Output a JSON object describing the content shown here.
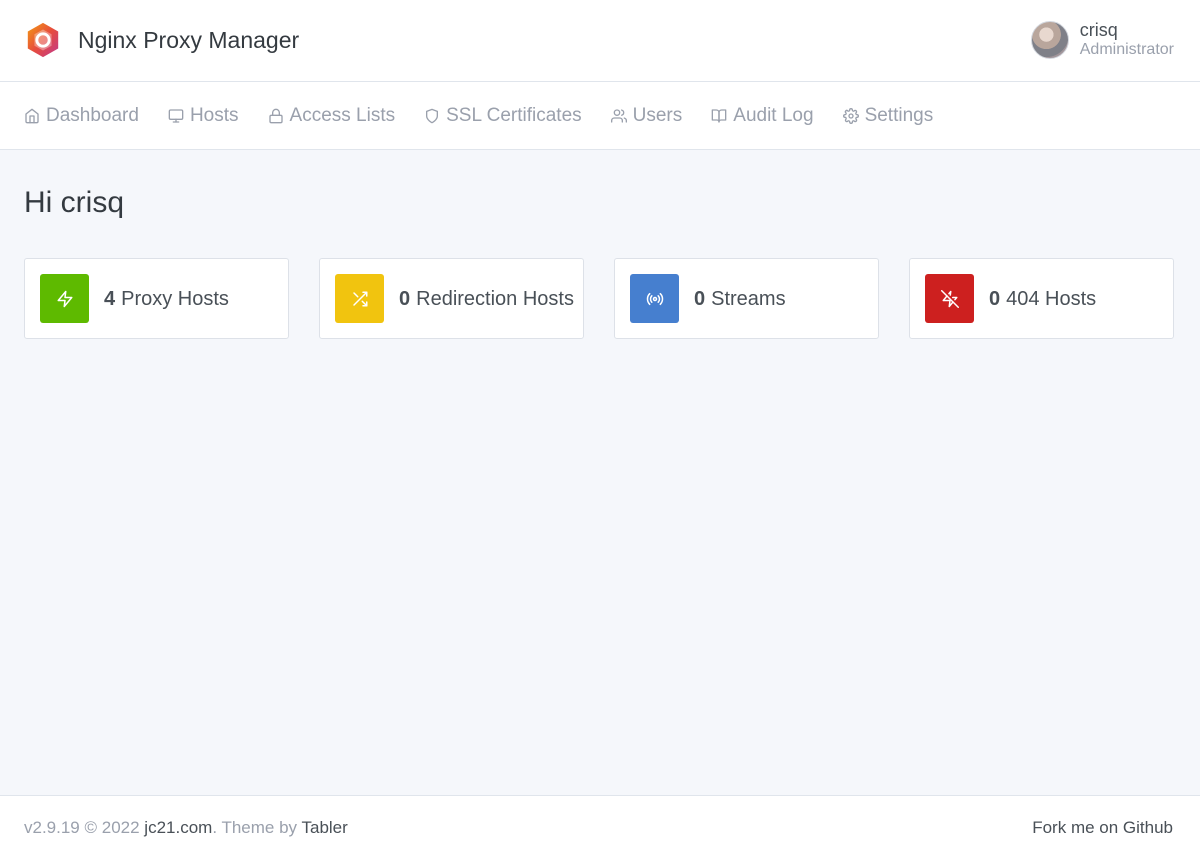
{
  "header": {
    "title": "Nginx Proxy Manager",
    "logo_icon": "nginx-proxy-manager-logo",
    "user": {
      "name": "crisq",
      "role": "Administrator",
      "avatar_icon": "user-avatar"
    }
  },
  "nav": {
    "items": [
      {
        "label": "Dashboard",
        "icon": "home-icon"
      },
      {
        "label": "Hosts",
        "icon": "monitor-icon"
      },
      {
        "label": "Access Lists",
        "icon": "lock-icon"
      },
      {
        "label": "SSL Certificates",
        "icon": "shield-icon"
      },
      {
        "label": "Users",
        "icon": "users-icon"
      },
      {
        "label": "Audit Log",
        "icon": "book-open-icon"
      },
      {
        "label": "Settings",
        "icon": "gear-icon"
      }
    ]
  },
  "main": {
    "greeting": "Hi crisq",
    "cards": [
      {
        "count": "4",
        "label": "Proxy Hosts",
        "icon": "zap-icon",
        "color": "#5eba00"
      },
      {
        "count": "0",
        "label": "Redirection Hosts",
        "icon": "shuffle-icon",
        "color": "#f1c40f"
      },
      {
        "count": "0",
        "label": "Streams",
        "icon": "radio-icon",
        "color": "#467fcf"
      },
      {
        "count": "0",
        "label": "404 Hosts",
        "icon": "zap-off-icon",
        "color": "#cd201f"
      }
    ]
  },
  "footer": {
    "version": "v2.9.19 © 2022",
    "company_link": "jc21.com",
    "theme_text": ". Theme by",
    "theme_link": "Tabler",
    "github_link": "Fork me on Github"
  }
}
